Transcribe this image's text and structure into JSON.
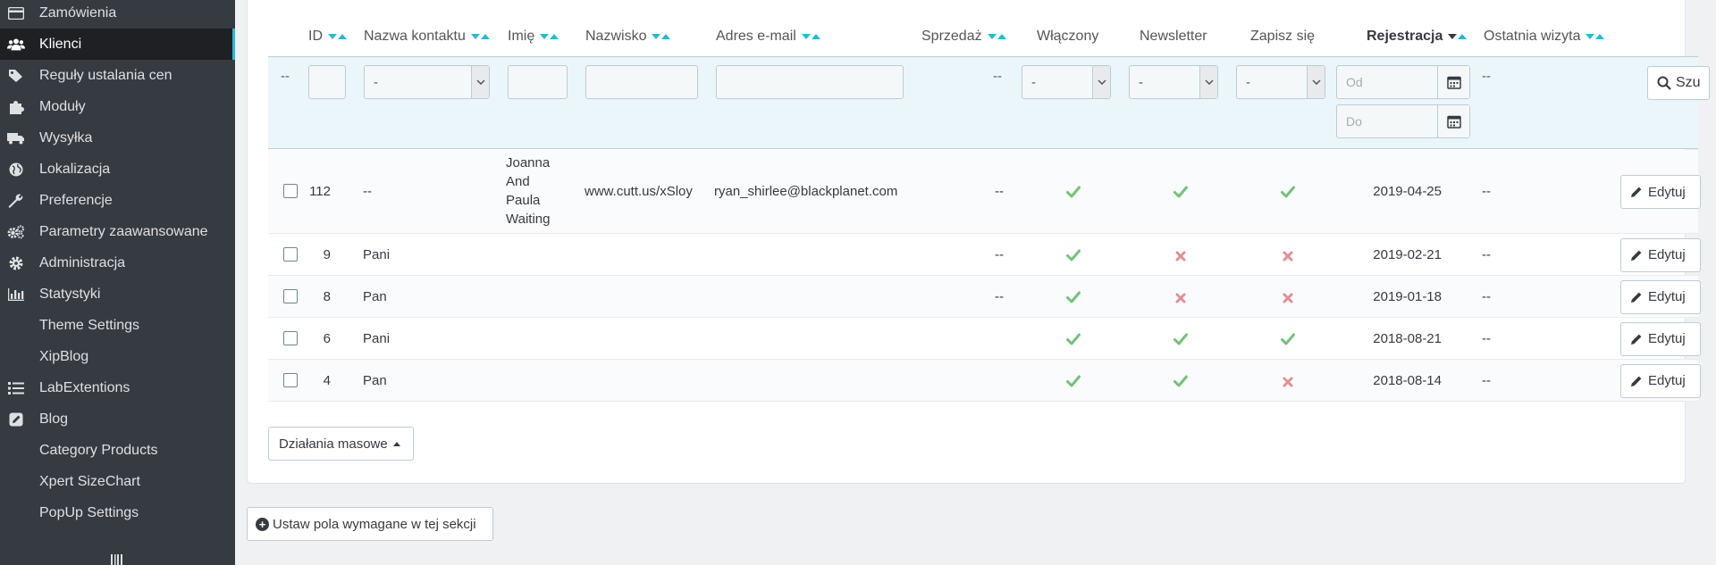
{
  "sidebar": {
    "items": [
      {
        "label": "Zamówienia",
        "icon": "credit-card-icon"
      },
      {
        "label": "Klienci",
        "icon": "users-icon",
        "active": true
      },
      {
        "label": "Reguły ustalania cen",
        "icon": "tags-icon"
      },
      {
        "label": "Moduły",
        "icon": "puzzle-icon"
      },
      {
        "label": "Wysyłka",
        "icon": "truck-icon"
      },
      {
        "label": "Lokalizacja",
        "icon": "globe-icon"
      },
      {
        "label": "Preferencje",
        "icon": "wrench-icon"
      },
      {
        "label": "Parametry zaawansowane",
        "icon": "cogs-icon"
      },
      {
        "label": "Administracja",
        "icon": "gear-icon"
      },
      {
        "label": "Statystyki",
        "icon": "bar-chart-icon"
      },
      {
        "label": "Theme Settings",
        "icon": ""
      },
      {
        "label": "XipBlog",
        "icon": ""
      },
      {
        "label": "LabExtentions",
        "icon": "list-icon"
      },
      {
        "label": "Blog",
        "icon": "edit-square-icon"
      },
      {
        "label": "Category Products",
        "icon": ""
      },
      {
        "label": "Xpert SizeChart",
        "icon": ""
      },
      {
        "label": "PopUp Settings",
        "icon": ""
      }
    ]
  },
  "table": {
    "headers": {
      "id": "ID",
      "contact": "Nazwa kontaktu",
      "firstname": "Imię",
      "lastname": "Nazwisko",
      "email": "Adres e-mail",
      "sales": "Sprzedaż",
      "enabled": "Włączony",
      "newsletter": "Newsletter",
      "optin": "Zapisz się",
      "registration": "Rejestracja",
      "last_visit": "Ostatnia wizyta"
    },
    "filters": {
      "dash": "--",
      "select_value": "-",
      "date_from_placeholder": "Od",
      "date_to_placeholder": "Do",
      "search_label": "Szu"
    },
    "rows": [
      {
        "id": "112",
        "contact": "--",
        "firstname": "Joanna And Paula Waiting",
        "firstname_lines": [
          "Joanna",
          "And",
          "Paula",
          "Waiting"
        ],
        "lastname": "www.cutt.us/xSloy",
        "email": "ryan_shirlee@blackplanet.com",
        "sales": "--",
        "enabled": true,
        "newsletter": true,
        "optin": true,
        "registration": "2019-04-25",
        "last_visit": "--"
      },
      {
        "id": "9",
        "contact": "Pani",
        "firstname": "",
        "lastname": "",
        "email": "",
        "sales": "--",
        "enabled": true,
        "newsletter": false,
        "optin": false,
        "registration": "2019-02-21",
        "last_visit": "--"
      },
      {
        "id": "8",
        "contact": "Pan",
        "firstname": "",
        "lastname": "",
        "email": "",
        "sales": "--",
        "enabled": true,
        "newsletter": false,
        "optin": false,
        "registration": "2019-01-18",
        "last_visit": "--"
      },
      {
        "id": "6",
        "contact": "Pani",
        "firstname": "",
        "lastname": "",
        "email": "",
        "sales": "",
        "enabled": true,
        "newsletter": true,
        "optin": true,
        "registration": "2018-08-21",
        "last_visit": "--"
      },
      {
        "id": "4",
        "contact": "Pan",
        "firstname": "",
        "lastname": "",
        "email": "",
        "sales": "",
        "enabled": true,
        "newsletter": true,
        "optin": false,
        "registration": "2018-08-14",
        "last_visit": "--"
      }
    ],
    "edit_label": "Edytuj"
  },
  "bulk_actions_label": "Działania masowe",
  "required_fields_label": "Ustaw pola wymagane w tej sekcji",
  "colors": {
    "accent": "#25b9d7",
    "check": "#72c279",
    "cross": "#e08f95",
    "sidebar": "#363a41"
  }
}
